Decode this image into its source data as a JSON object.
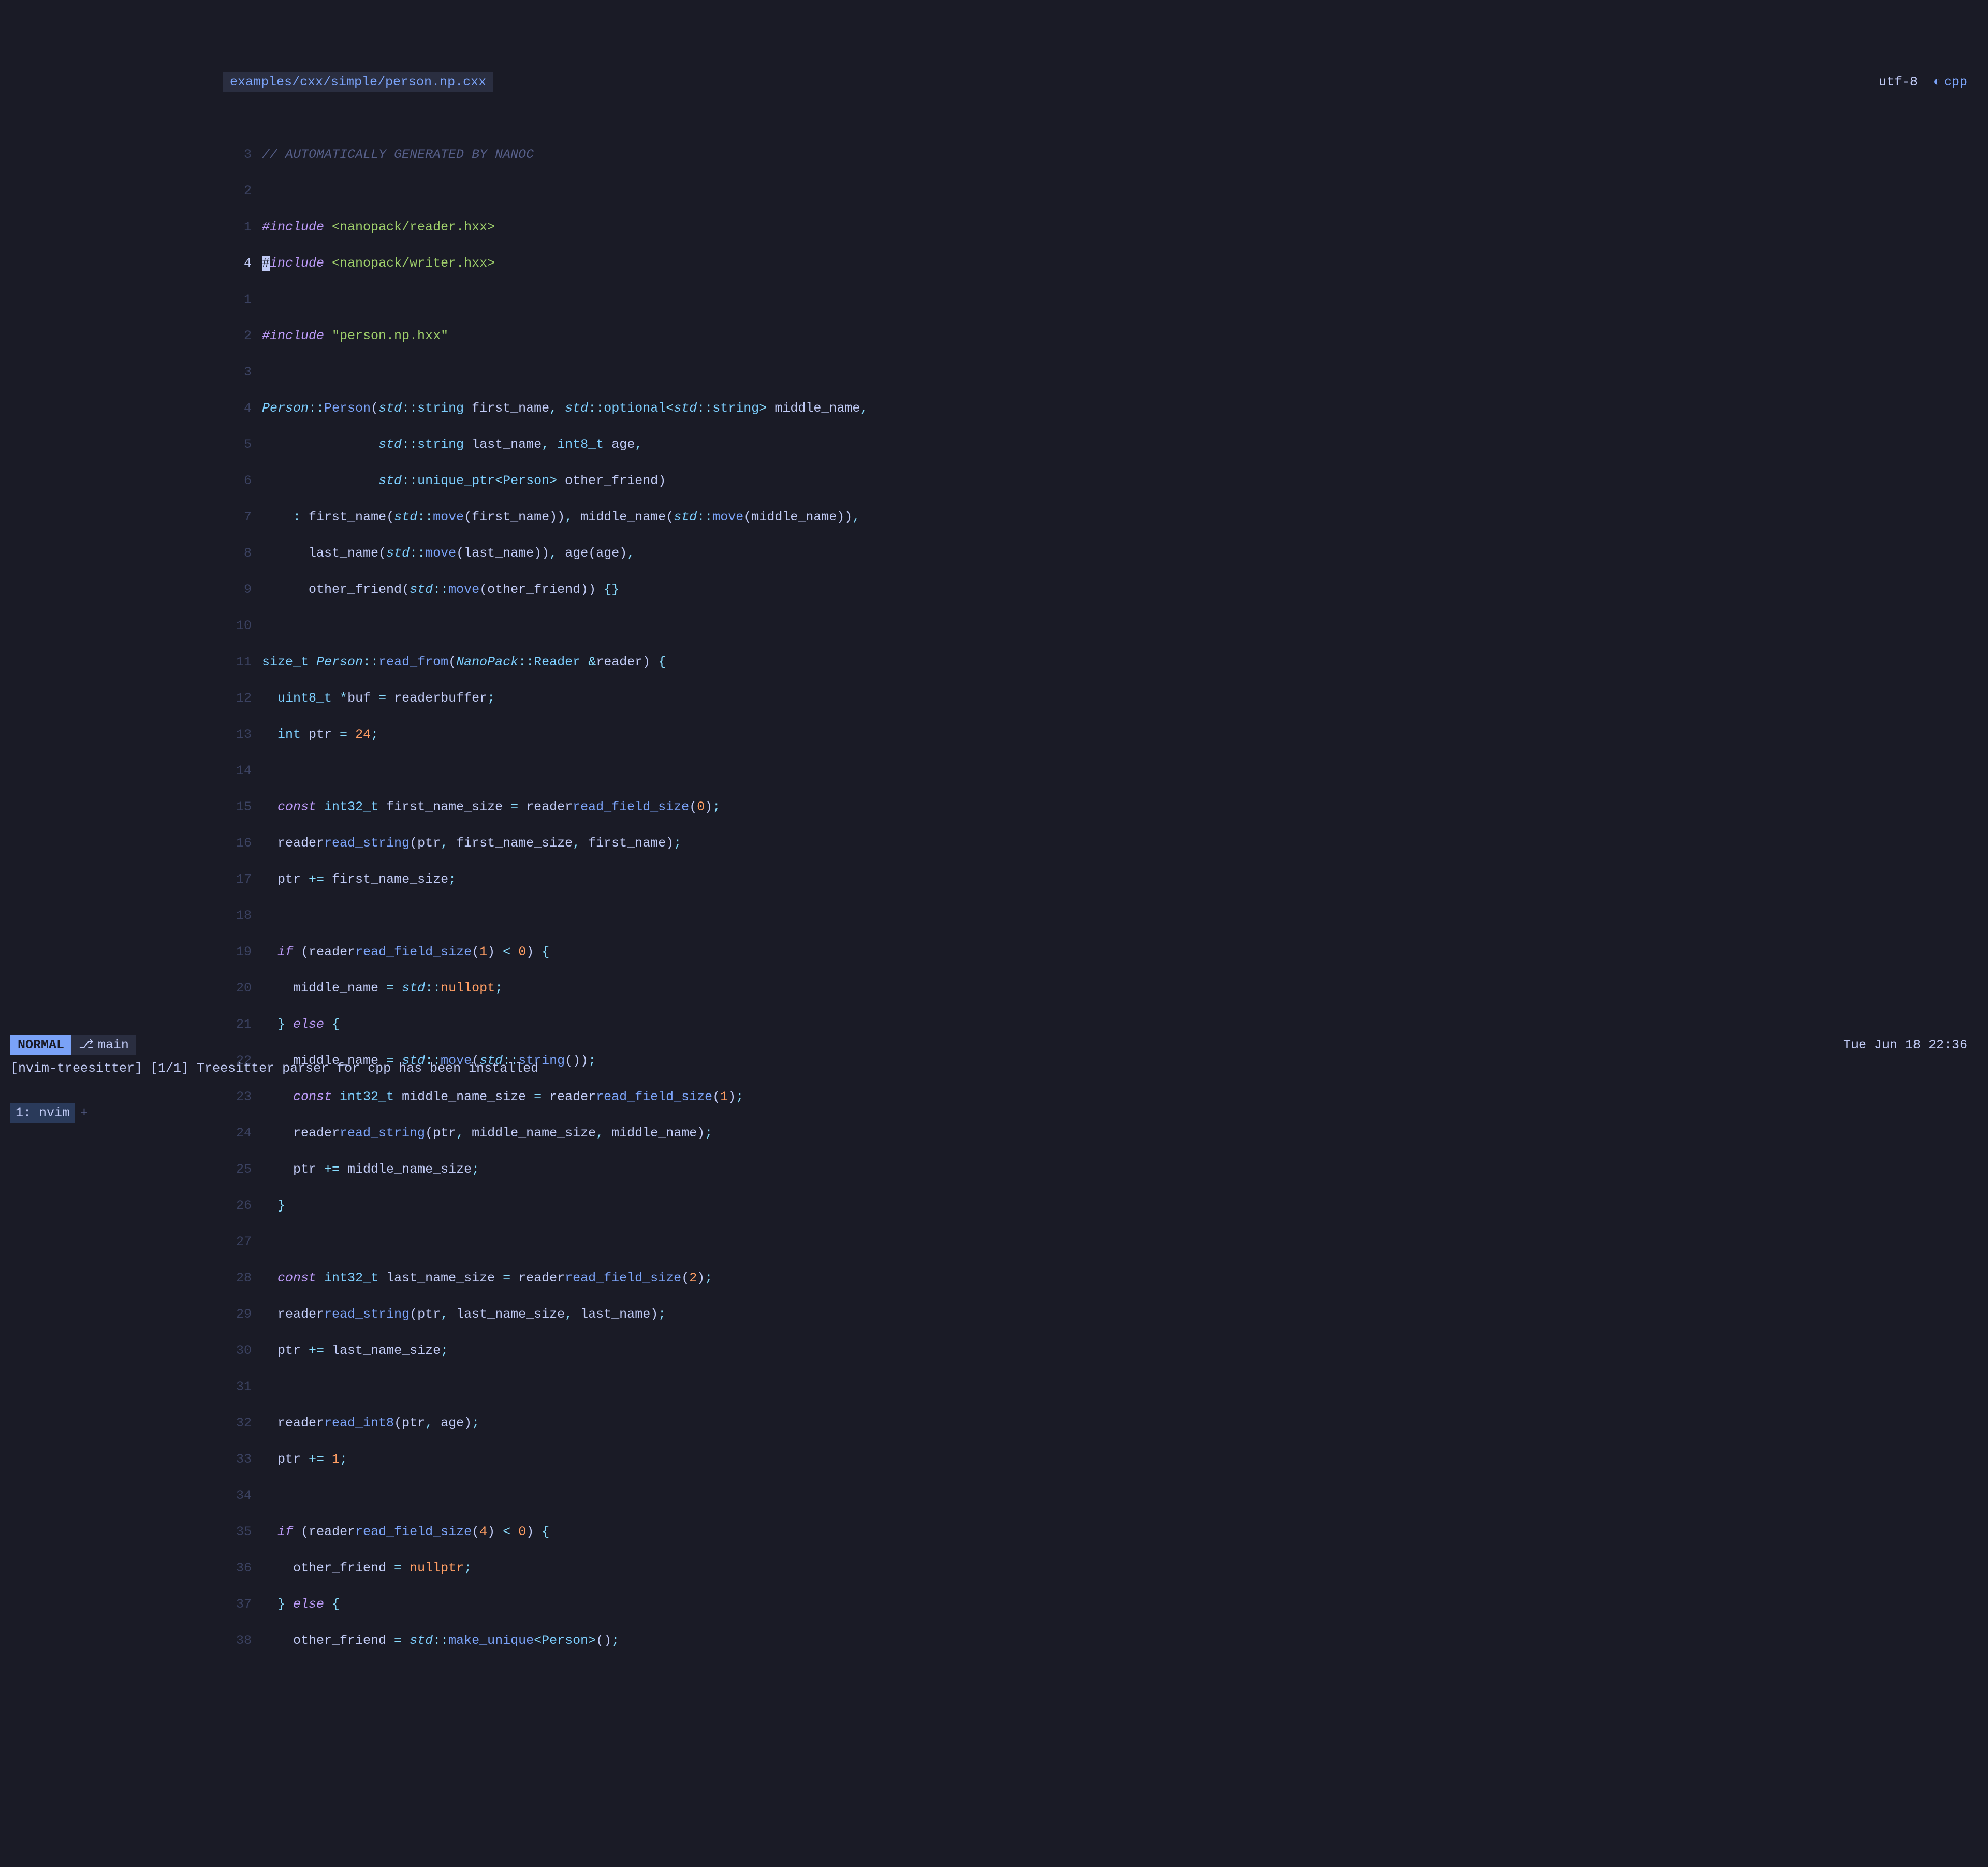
{
  "tabline": {
    "filename": "examples/cxx/simple/person.np.cxx",
    "encoding": "utf-8",
    "filetype": "cpp",
    "filetype_icon": "◐"
  },
  "gutter": [
    "3",
    "2",
    "1",
    "4",
    "1",
    "2",
    "3",
    "4",
    "5",
    "6",
    "7",
    "8",
    "9",
    "10",
    "11",
    "12",
    "13",
    "14",
    "15",
    "16",
    "17",
    "18",
    "19",
    "20",
    "21",
    "22",
    "23",
    "24",
    "25",
    "26",
    "27",
    "28",
    "29",
    "30",
    "31",
    "32",
    "33",
    "34",
    "35",
    "36",
    "37",
    "38"
  ],
  "current_line_index": 3,
  "code": {
    "l0": "// AUTOMATICALLY GENERATED BY NANOC",
    "l1": "",
    "l2_pre": "#include ",
    "l2_str": "<nanopack/reader.hxx>",
    "l3_cursor": "#",
    "l3_pre": "include ",
    "l3_str": "<nanopack/writer.hxx>",
    "l4": "",
    "l5_pre": "#include ",
    "l5_str": "\"person.np.hxx\"",
    "l6": "",
    "l7": {
      "Person": "Person",
      "col": "::",
      "Person2": "Person",
      "open": "(",
      "std": "std",
      "col2": "::",
      "string": "string ",
      "first_name": "first_name",
      ",": ", ",
      "std2": "std",
      "col3": "::",
      "optional": "optional",
      "lt": "<",
      "std3": "std",
      "col4": "::",
      "string2": "string",
      "gt": ">",
      " ": " ",
      "middle_name": "middle_name",
      ",2": ","
    },
    "l8": {
      "indent": "               ",
      "std": "std",
      "col": "::",
      "string": "string ",
      "last_name": "last_name",
      ",": ", ",
      "int8_t": "int8_t ",
      "age": "age",
      ",2": ","
    },
    "l9": {
      "indent": "               ",
      "std": "std",
      "col": "::",
      "unique_ptr": "unique_ptr",
      "lt": "<",
      "Person": "Person",
      "gt": ">",
      " ": " ",
      "other_friend": "other_friend",
      ")": ")"
    },
    "l10": {
      "indent": "    ",
      ":": ":",
      " ": " ",
      "first_name": "first_name",
      "open": "(",
      "std": "std",
      "col": "::",
      "move": "move",
      "open2": "(",
      "first_name2": "first_name",
      "close": "))",
      ",": ", ",
      "middle_name": "middle_name",
      "open3": "(",
      "std2": "std",
      "col2": "::",
      "move2": "move",
      "open4": "(",
      "middle_name2": "middle_name",
      "close2": "))",
      ",2": ","
    },
    "l11": {
      "indent": "      ",
      "last_name": "last_name",
      "open": "(",
      "std": "std",
      "col": "::",
      "move": "move",
      "open2": "(",
      "last_name2": "last_name",
      "close": "))",
      ",": ", ",
      "age": "age",
      "open3": "(",
      "age2": "age",
      "close2": ")",
      ",2": ","
    },
    "l12": {
      "indent": "      ",
      "other_friend": "other_friend",
      "open": "(",
      "std": "std",
      "col": "::",
      "move": "move",
      "open2": "(",
      "other_friend2": "other_friend",
      "close": "))",
      " ": " ",
      "braces": "{}"
    },
    "l13": "",
    "l14": {
      "size_t": "size_t ",
      "Person": "Person",
      "col": "::",
      "read_from": "read_from",
      "open": "(",
      "NanoPack": "NanoPack",
      "col2": "::",
      "Reader": "Reader ",
      "amp": "&",
      "reader": "reader",
      "close": ")",
      " ": " ",
      "brace": "{"
    },
    "l15": {
      "indent": "  ",
      "uint8_t": "uint8_t ",
      "star": "*",
      "buf": "buf",
      " = ": " = ",
      "reader": "reader",
      ".": ".",
      "buffer": "buffer",
      ";": ";"
    },
    "l16": {
      "indent": "  ",
      "int": "int ",
      "ptr": "ptr",
      " = ": " = ",
      "num": "24",
      ";": ";"
    },
    "l17": "",
    "l18": {
      "indent": "  ",
      "const": "const ",
      "int32_t": "int32_t ",
      "first_name_size": "first_name_size",
      " = ": " = ",
      "reader": "reader",
      ".": ".",
      "read_field_size": "read_field_size",
      "open": "(",
      "num": "0",
      "close": ")",
      ";": ";"
    },
    "l19": {
      "indent": "  ",
      "reader": "reader",
      ".": ".",
      "read_string": "read_string",
      "open": "(",
      "ptr": "ptr",
      ",": ", ",
      "first_name_size": "first_name_size",
      ",2": ", ",
      "first_name": "first_name",
      "close": ")",
      ";": ";"
    },
    "l20": {
      "indent": "  ",
      "ptr": "ptr",
      " += ": " += ",
      "first_name_size": "first_name_size",
      ";": ";"
    },
    "l21": "",
    "l22": {
      "indent": "  ",
      "if": "if",
      " ": " ",
      "open": "(",
      "reader": "reader",
      ".": ".",
      "read_field_size": "read_field_size",
      "open2": "(",
      "num": "1",
      "close": ")",
      " < ": " < ",
      "zero": "0",
      "close2": ")",
      " {": " {"
    },
    "l23": {
      "indent": "    ",
      "middle_name": "middle_name",
      " = ": " = ",
      "std": "std",
      "col": "::",
      "nullopt": "nullopt",
      ";": ";"
    },
    "l24": {
      "indent": "  ",
      "brace": "}",
      " ": " ",
      "else": "else",
      " {": " {"
    },
    "l25": {
      "indent": "    ",
      "middle_name": "middle_name",
      " = ": " = ",
      "std": "std",
      "col": "::",
      "move": "move",
      "open": "(",
      "std2": "std",
      "col2": "::",
      "string": "string",
      "open2": "(",
      "close": "))",
      ";": ";"
    },
    "l26": {
      "indent": "    ",
      "const": "const ",
      "int32_t": "int32_t ",
      "middle_name_size": "middle_name_size",
      " = ": " = ",
      "reader": "reader",
      ".": ".",
      "read_field_size": "read_field_size",
      "open": "(",
      "num": "1",
      "close": ")",
      ";": ";"
    },
    "l27": {
      "indent": "    ",
      "reader": "reader",
      ".": ".",
      "read_string": "read_string",
      "open": "(",
      "ptr": "ptr",
      ",": ", ",
      "middle_name_size": "middle_name_size",
      ",2": ", ",
      "middle_name": "middle_name",
      "close": ")",
      ";": ";"
    },
    "l28": {
      "indent": "    ",
      "ptr": "ptr",
      " += ": " += ",
      "middle_name_size": "middle_name_size",
      ";": ";"
    },
    "l29": {
      "indent": "  ",
      "brace": "}"
    },
    "l30": "",
    "l31": {
      "indent": "  ",
      "const": "const ",
      "int32_t": "int32_t ",
      "last_name_size": "last_name_size",
      " = ": " = ",
      "reader": "reader",
      ".": ".",
      "read_field_size": "read_field_size",
      "open": "(",
      "num": "2",
      "close": ")",
      ";": ";"
    },
    "l32": {
      "indent": "  ",
      "reader": "reader",
      ".": ".",
      "read_string": "read_string",
      "open": "(",
      "ptr": "ptr",
      ",": ", ",
      "last_name_size": "last_name_size",
      ",2": ", ",
      "last_name": "last_name",
      "close": ")",
      ";": ";"
    },
    "l33": {
      "indent": "  ",
      "ptr": "ptr",
      " += ": " += ",
      "last_name_size": "last_name_size",
      ";": ";"
    },
    "l34": "",
    "l35": {
      "indent": "  ",
      "reader": "reader",
      ".": ".",
      "read_int8": "read_int8",
      "open": "(",
      "ptr": "ptr",
      ",": ", ",
      "age": "age",
      "close": ")",
      ";": ";"
    },
    "l36": {
      "indent": "  ",
      "ptr": "ptr",
      " += ": " += ",
      "num": "1",
      ";": ";"
    },
    "l37": "",
    "l38": {
      "indent": "  ",
      "if": "if",
      " ": " ",
      "open": "(",
      "reader": "reader",
      ".": ".",
      "read_field_size": "read_field_size",
      "open2": "(",
      "num": "4",
      "close": ")",
      " < ": " < ",
      "zero": "0",
      "close2": ")",
      " {": " {"
    },
    "l39": {
      "indent": "    ",
      "other_friend": "other_friend",
      " = ": " = ",
      "nullptr": "nullptr",
      ";": ";"
    },
    "l40": {
      "indent": "  ",
      "brace": "}",
      " ": " ",
      "else": "else",
      " {": " {"
    },
    "l41": {
      "indent": "    ",
      "other_friend": "other_friend",
      " = ": " = ",
      "std": "std",
      "col": "::",
      "make_unique": "make_unique",
      "lt": "<",
      "Person": "Person",
      "gt": ">",
      "open": "(",
      ")": ")",
      ";": ";"
    }
  },
  "statusline": {
    "mode": "NORMAL",
    "branch_icon": "⎇",
    "branch": "main",
    "datetime": "Tue Jun 18 22:36"
  },
  "message": "[nvim-treesitter] [1/1] Treesitter parser for cpp has been installed",
  "tmux": {
    "window": "1: nvim",
    "plus": "+"
  }
}
